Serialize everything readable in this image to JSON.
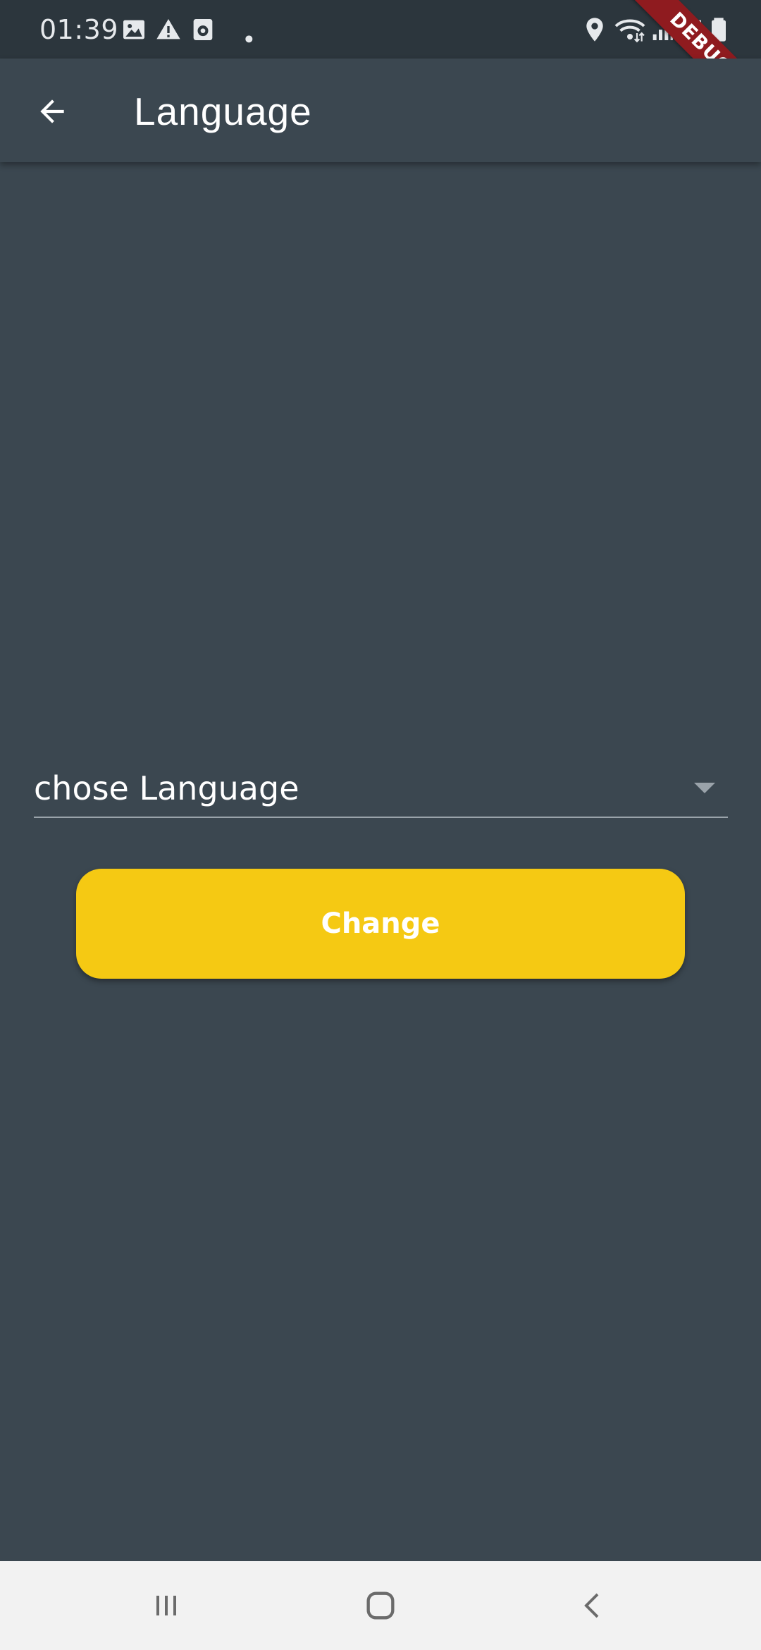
{
  "status_bar": {
    "time": "01:39",
    "left_icons": [
      "image-icon",
      "warning-icon",
      "media-icon",
      "dot-icon"
    ],
    "right_icons": [
      "location-icon",
      "wifi-icon",
      "signal-icon",
      "signal-icon",
      "battery-icon"
    ]
  },
  "debug_banner": {
    "label": "DEBUG",
    "color": "#8f1b1f"
  },
  "app_bar": {
    "back_icon": "arrow-back-icon",
    "title": "Language"
  },
  "language_dropdown": {
    "hint": "chose Language",
    "arrow_icon": "dropdown-arrow-icon"
  },
  "change_button": {
    "label": "Change",
    "color": "#f5c913"
  },
  "nav_bar": {
    "items": [
      "recent-apps-icon",
      "home-icon",
      "back-icon"
    ]
  },
  "colors": {
    "background": "#3b4750",
    "status_bar": "#2c363d",
    "nav_bar": "#f2f2f2",
    "accent": "#f5c913"
  }
}
